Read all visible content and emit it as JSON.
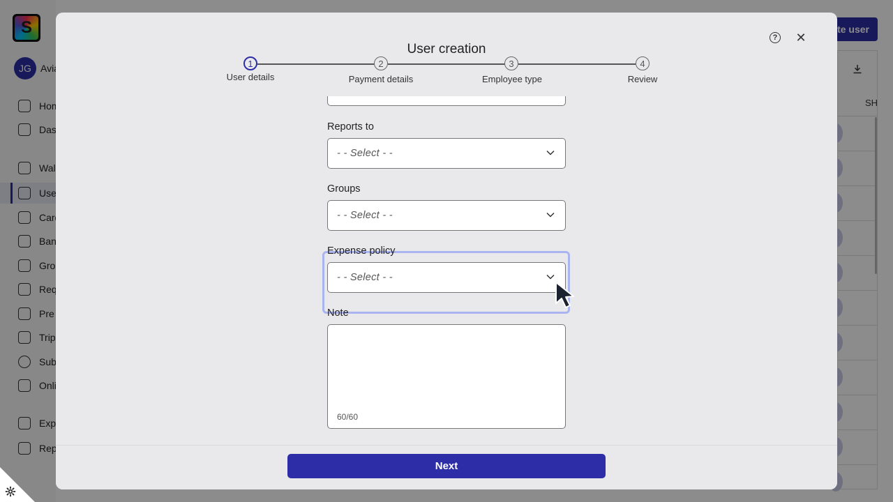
{
  "background": {
    "logo_letter": "S",
    "user": {
      "initials": "JG",
      "name": "Avia"
    },
    "nav_items": [
      {
        "label": "Home",
        "icon": "home-icon"
      },
      {
        "label": "Dashboard",
        "icon": "dashboard-icon"
      },
      {
        "label": "Wallet",
        "icon": "wallet-icon"
      },
      {
        "label": "Users",
        "icon": "users-icon",
        "active": true
      },
      {
        "label": "Cards",
        "icon": "cards-icon"
      },
      {
        "label": "Bank",
        "icon": "transfer-icon"
      },
      {
        "label": "Groups",
        "icon": "groups-icon"
      },
      {
        "label": "Requests",
        "icon": "requests-icon"
      },
      {
        "label": "Pre",
        "icon": "pre-icon"
      },
      {
        "label": "Trips",
        "icon": "plane-icon"
      },
      {
        "label": "Subscriptions",
        "icon": "clock-icon"
      },
      {
        "label": "Online",
        "icon": "megaphone-icon"
      },
      {
        "label": "Expenses",
        "icon": "coins-icon"
      },
      {
        "label": "Reports",
        "icon": "reports-icon"
      }
    ],
    "create_button": "te user",
    "table_header": "SH"
  },
  "modal": {
    "title": "User creation",
    "steps": [
      {
        "number": "1",
        "label": "User details",
        "active": true
      },
      {
        "number": "2",
        "label": "Payment details"
      },
      {
        "number": "3",
        "label": "Employee type"
      },
      {
        "number": "4",
        "label": "Review"
      }
    ],
    "fields": {
      "reports_to": {
        "label": "Reports to",
        "placeholder": "- - Select - -"
      },
      "groups": {
        "label": "Groups",
        "placeholder": "- - Select - -"
      },
      "expense_policy": {
        "label": "Expense policy",
        "placeholder": "- - Select - -"
      },
      "note": {
        "label": "Note",
        "counter": "60/60"
      }
    },
    "next_button": "Next"
  },
  "colors": {
    "accent": "#2d2ea7",
    "focus_ring": "#aab4f0"
  }
}
